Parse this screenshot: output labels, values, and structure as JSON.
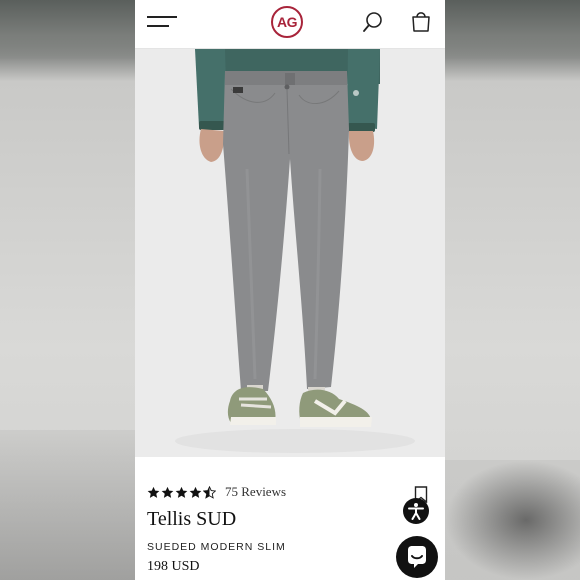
{
  "header": {
    "logo_text": "AG",
    "icons": {
      "menu": "hamburger-menu-icon",
      "search": "search-icon",
      "bag": "shopping-bag-icon"
    }
  },
  "product": {
    "rating": 4.5,
    "reviews_label": "75 Reviews",
    "name": "Tellis SUD",
    "subtitle": "SUEDED MODERN SLIM",
    "price": "198 USD"
  },
  "colors": {
    "brand": "#a8243a",
    "pants": "#8a8b8d",
    "shirt": "#3f6660"
  }
}
